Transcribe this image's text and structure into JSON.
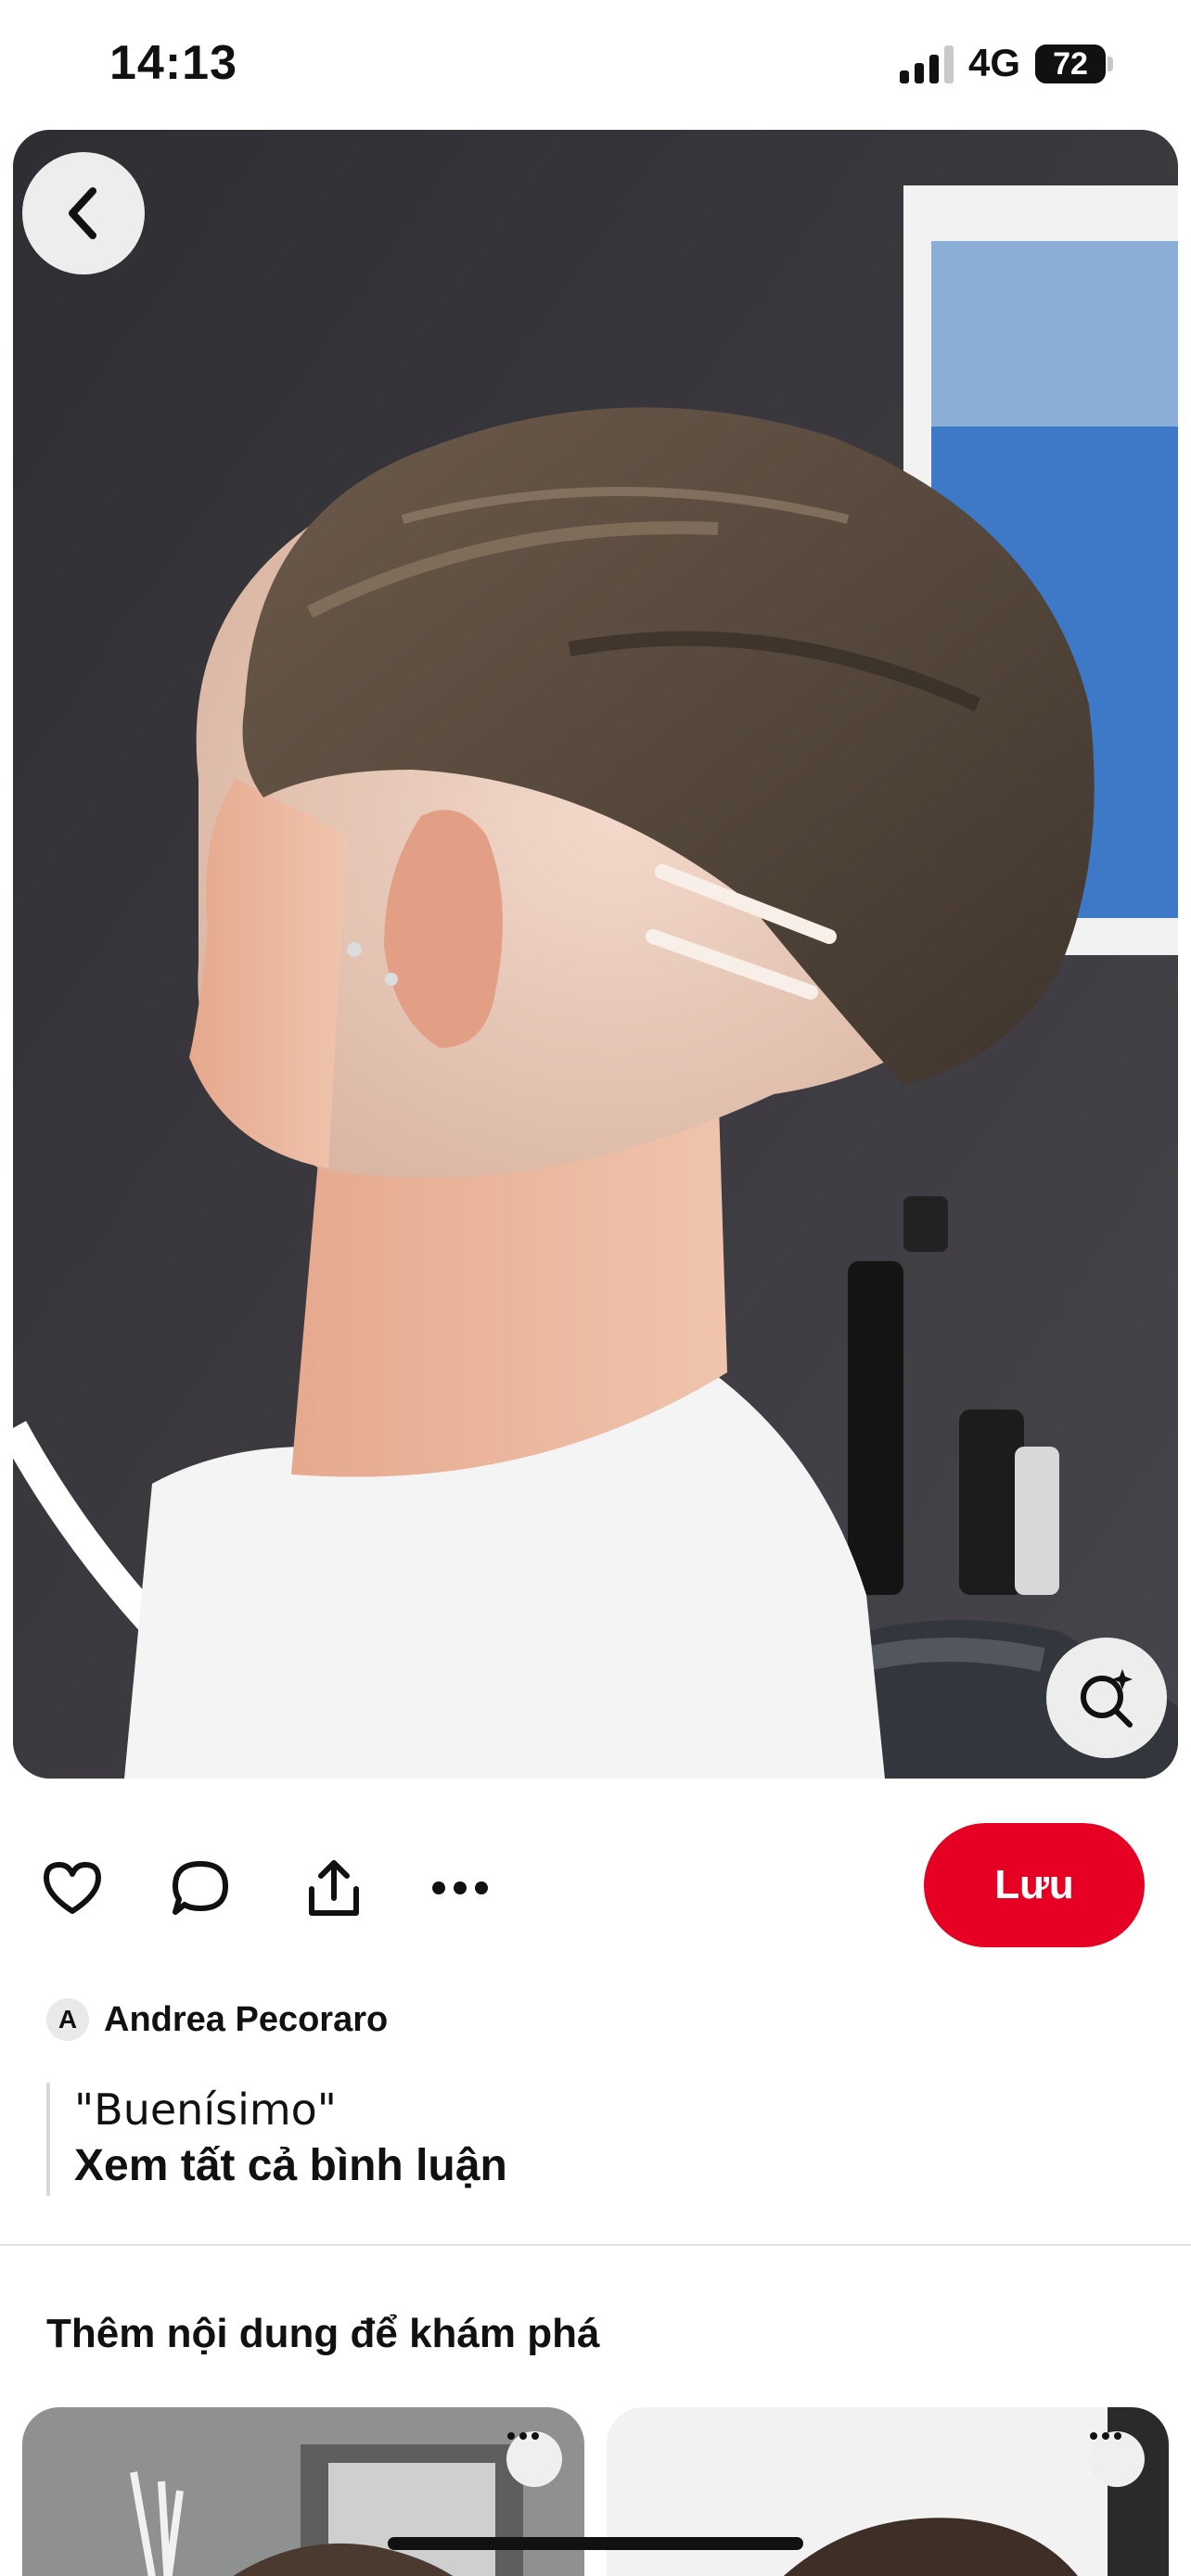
{
  "status_bar": {
    "time": "14:13",
    "network": "4G",
    "battery": "72",
    "battery_level": 0.72
  },
  "hero": {
    "back_icon": "chevron-left-icon",
    "lens_icon": "visual-search-icon"
  },
  "actions": {
    "like_icon": "heart-icon",
    "comment_icon": "comment-icon",
    "share_icon": "share-icon",
    "more_icon": "more-icon",
    "save_label": "Lưu",
    "save_color": "#e60023"
  },
  "author": {
    "avatar_letter": "A",
    "name": "Andrea Pecoraro"
  },
  "comment": {
    "text": "\"Buenísimo\"",
    "see_all": "Xem tất cả bình luận"
  },
  "more_section": {
    "title": "Thêm nội dung để khám phá"
  }
}
